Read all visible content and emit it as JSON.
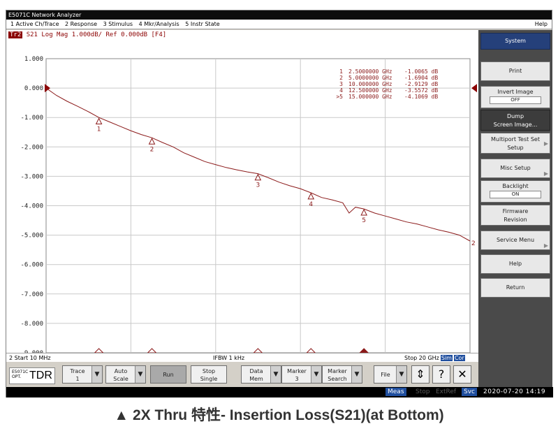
{
  "window": {
    "title": "E5071C Network Analyzer"
  },
  "menu": {
    "items": [
      "1 Active Ch/Trace",
      "2 Response",
      "3 Stimulus",
      "4 Mkr/Analysis",
      "5 Instr State"
    ],
    "help": "Help"
  },
  "trace_header": {
    "badge": "Tr2",
    "text": "S21 Log Mag 1.000dB/ Ref 0.000dB [F4]"
  },
  "marker_table": [
    {
      "id": "1",
      "freq": "2.5000000 GHz",
      "value": "-1.0065 dB"
    },
    {
      "id": "2",
      "freq": "5.0000000 GHz",
      "value": "-1.6904 dB"
    },
    {
      "id": "3",
      "freq": "10.000000 GHz",
      "value": "-2.9129 dB"
    },
    {
      "id": "4",
      "freq": "12.500000 GHz",
      "value": "-3.5572 dB"
    },
    {
      "id": ">5",
      "freq": "15.000000 GHz",
      "value": "-4.1069 dB"
    }
  ],
  "chart_data": {
    "type": "line",
    "title": "",
    "xlabel": "",
    "ylabel": "",
    "xlim": [
      0.01,
      20
    ],
    "ylim": [
      -9,
      1
    ],
    "yticks": [
      "1.000",
      "0.000",
      "-1.000",
      "-2.000",
      "-3.000",
      "-4.000",
      "-5.000",
      "-6.000",
      "-7.000",
      "-8.000",
      "-9.000"
    ],
    "grid": true,
    "series": [
      {
        "color": "#8b1a1a",
        "x": [
          0.01,
          0.5,
          1.0,
          1.5,
          2.0,
          2.5,
          3.0,
          3.5,
          4.0,
          4.5,
          5.0,
          5.5,
          6.0,
          6.5,
          7.0,
          7.5,
          8.0,
          8.5,
          9.0,
          9.5,
          10.0,
          10.5,
          11.0,
          11.5,
          12.0,
          12.5,
          13.0,
          13.5,
          14.0,
          14.3,
          14.6,
          15.0,
          15.5,
          16.0,
          16.5,
          17.0,
          17.5,
          18.0,
          18.5,
          19.0,
          19.5,
          20.0
        ],
        "y": [
          0.0,
          -0.25,
          -0.45,
          -0.62,
          -0.8,
          -1.0,
          -1.15,
          -1.3,
          -1.45,
          -1.58,
          -1.69,
          -1.85,
          -2.0,
          -2.2,
          -2.35,
          -2.5,
          -2.6,
          -2.7,
          -2.78,
          -2.85,
          -2.91,
          -3.05,
          -3.2,
          -3.32,
          -3.42,
          -3.56,
          -3.72,
          -3.8,
          -3.9,
          -4.25,
          -4.05,
          -4.11,
          -4.25,
          -4.35,
          -4.45,
          -4.55,
          -4.62,
          -4.72,
          -4.82,
          -4.9,
          -5.0,
          -5.2
        ]
      }
    ],
    "markers": [
      {
        "label": "1",
        "x": 2.5,
        "y": -1.0065
      },
      {
        "label": "2",
        "x": 5.0,
        "y": -1.6904
      },
      {
        "label": "3",
        "x": 10.0,
        "y": -2.9129
      },
      {
        "label": "4",
        "x": 12.5,
        "y": -3.5572
      },
      {
        "label": "5",
        "x": 15.0,
        "y": -4.1069,
        "active": true
      }
    ],
    "trace_end_label": "2"
  },
  "statusline": {
    "start": "2 Start 10 MHz",
    "ifbw": "IFBW 1 kHz",
    "stop": "Stop 20 GHz",
    "sim": "Sim",
    "cor": "Cor"
  },
  "toolbar": {
    "logo_opt": "E5071C\nOPT.",
    "logo_tdr": "TDR",
    "buttons": [
      {
        "line1": "Trace",
        "line2": "1",
        "dropdown": true
      },
      {
        "line1": "Auto",
        "line2": "Scale",
        "dropdown": true
      },
      {
        "line1": "Run",
        "line2": "",
        "dropdown": false,
        "pressed": true
      },
      {
        "line1": "Stop",
        "line2": "Single",
        "dropdown": false
      },
      {
        "line1": "Data",
        "line2": "Mem",
        "dropdown": true
      },
      {
        "line1": "Marker",
        "line2": "3",
        "dropdown": true
      },
      {
        "line1": "Marker",
        "line2": "Search",
        "dropdown": true
      },
      {
        "line1": "File",
        "line2": "",
        "dropdown": true
      }
    ],
    "icon_updown": "⇕",
    "icon_help": "?",
    "icon_close": "✕"
  },
  "bottombar": {
    "meas": "Meas",
    "stop": "Stop",
    "extref": "ExtRef",
    "svc": "Svc",
    "clock": "2020-07-20 14:19"
  },
  "softkeys": {
    "title": "System",
    "print": "Print",
    "invert_label": "Invert Image",
    "invert_value": "OFF",
    "dump_line1": "Dump",
    "dump_line2": "Screen Image...",
    "multiport_line1": "Multiport Test Set",
    "multiport_line2": "Setup",
    "misc": "Misc Setup",
    "backlight_label": "Backlight",
    "backlight_value": "ON",
    "firmware_line1": "Firmware",
    "firmware_line2": "Revision",
    "service": "Service Menu",
    "help": "Help",
    "return": "Return"
  },
  "caption": "▲ 2X Thru 特性- Insertion Loss(S21)(at Bottom)"
}
